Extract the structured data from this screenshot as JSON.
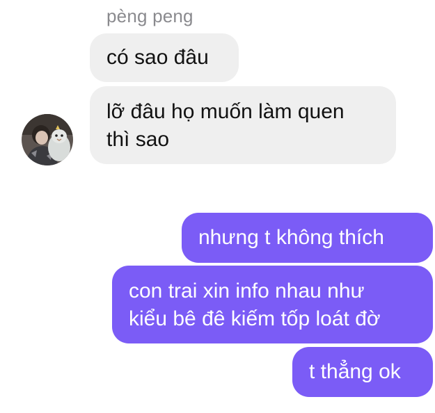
{
  "conversation": {
    "sender_name": "pèng peng",
    "incoming": [
      {
        "lines": [
          "có sao đâu"
        ]
      },
      {
        "lines": [
          "lỡ đâu họ muốn làm quen",
          "thì sao"
        ]
      }
    ],
    "outgoing": [
      {
        "lines": [
          "nhưng t không thích"
        ]
      },
      {
        "lines": [
          "con trai xin info nhau như",
          "kiểu bê đê kiếm tốp loát đờ"
        ]
      },
      {
        "lines": [
          "t thẳng ok"
        ]
      }
    ]
  },
  "colors": {
    "incoming_bubble": "#efefef",
    "outgoing_bubble": "#7b5cf6",
    "sender_name": "#8a8a8e"
  },
  "icons": {
    "avatar": "avatar-photo"
  }
}
